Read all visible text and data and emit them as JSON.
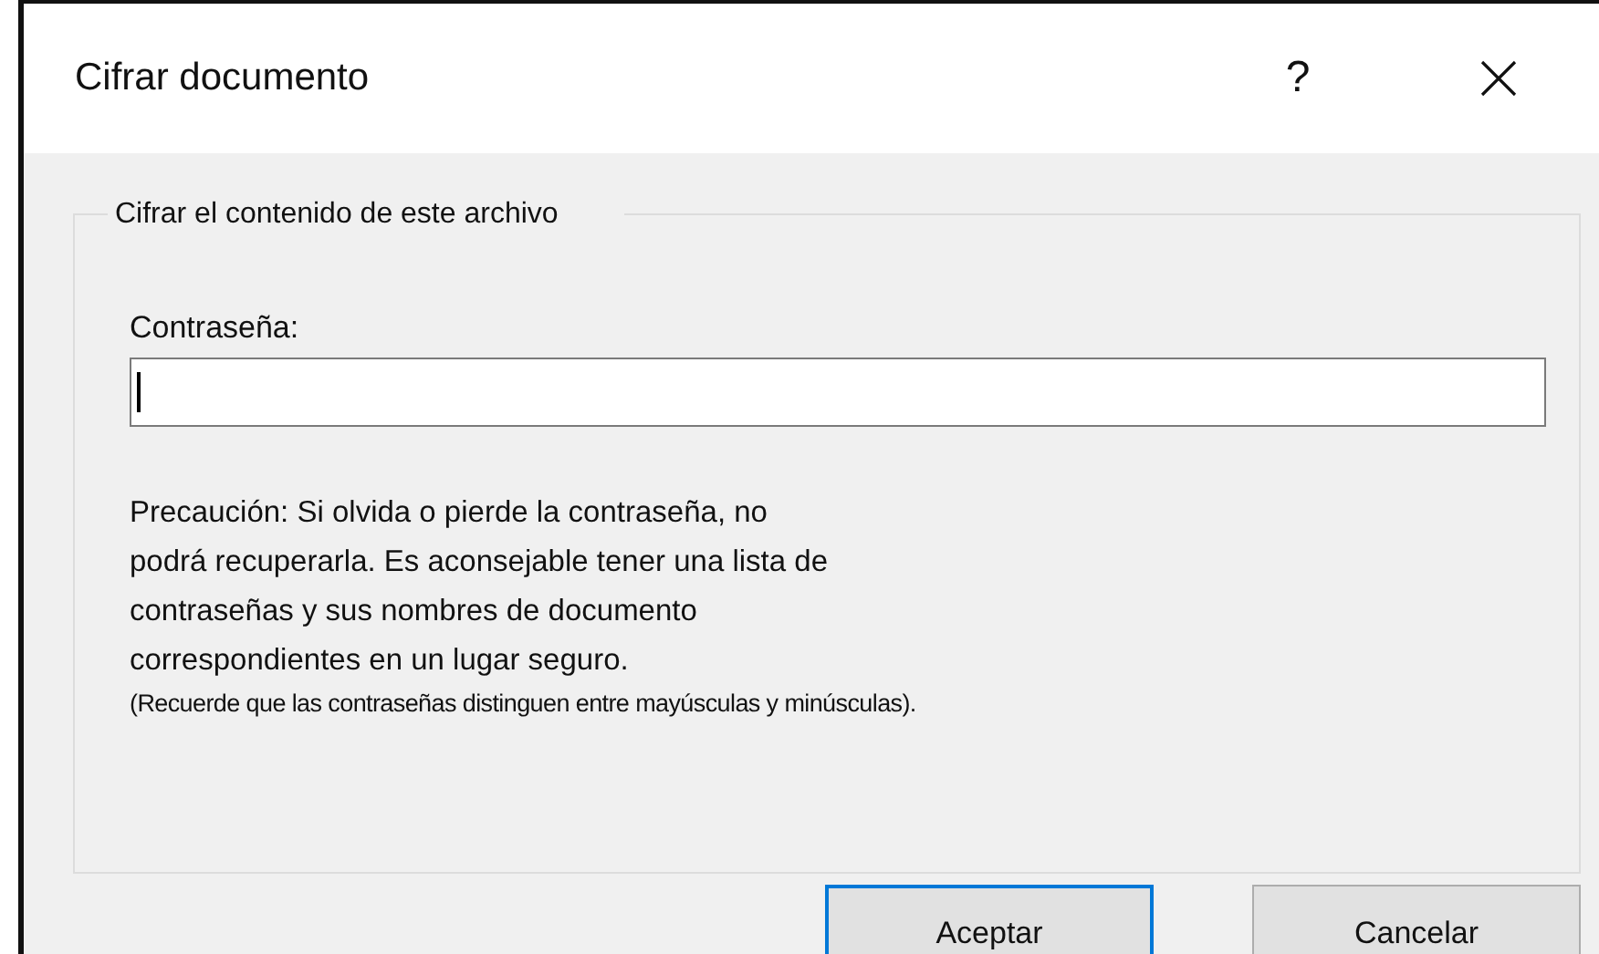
{
  "window": {
    "title": "Cifrar documento",
    "help": "?"
  },
  "group": {
    "legend": "Cifrar el contenido de este archivo",
    "password": {
      "label": "Contraseña:",
      "focused": true
    },
    "warning": "Precaución: Si olvida o pierde la contraseña, no podrá recuperarla. Es aconsejable tener una lista de contraseñas y sus nombres de documento correspondientes en un lugar seguro.",
    "note": "(Recuerde que las contraseñas distinguen entre mayúsculas y minúsculas)."
  },
  "buttons": [
    {
      "label": "Aceptar",
      "default": true
    },
    {
      "label": "Cancelar",
      "default": false
    }
  ]
}
